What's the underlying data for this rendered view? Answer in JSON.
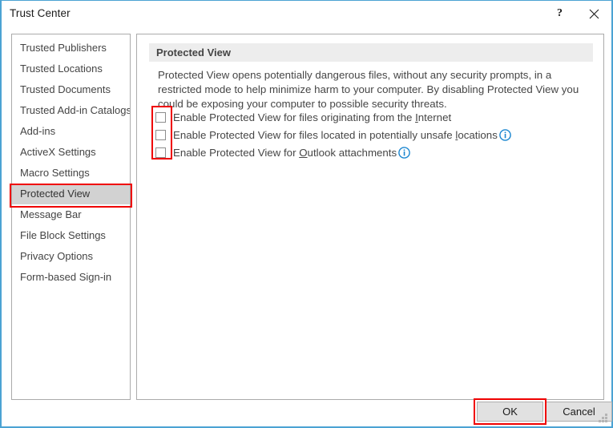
{
  "window": {
    "title": "Trust Center",
    "help_icon": "question-mark-icon",
    "close_icon": "close-icon",
    "accent_color": "#4ba3d3"
  },
  "sidebar": {
    "items": [
      {
        "label": "Trusted Publishers",
        "selected": false
      },
      {
        "label": "Trusted Locations",
        "selected": false
      },
      {
        "label": "Trusted Documents",
        "selected": false
      },
      {
        "label": "Trusted Add-in Catalogs",
        "selected": false
      },
      {
        "label": "Add-ins",
        "selected": false
      },
      {
        "label": "ActiveX Settings",
        "selected": false
      },
      {
        "label": "Macro Settings",
        "selected": false
      },
      {
        "label": "Protected View",
        "selected": true
      },
      {
        "label": "Message Bar",
        "selected": false
      },
      {
        "label": "File Block Settings",
        "selected": false
      },
      {
        "label": "Privacy Options",
        "selected": false
      },
      {
        "label": "Form-based Sign-in",
        "selected": false
      }
    ]
  },
  "main": {
    "section_title": "Protected View",
    "description": "Protected View opens potentially dangerous files, without any security prompts, in a restricted mode to help minimize harm to your computer. By disabling Protected View you could be exposing your computer to possible security threats.",
    "checkboxes": [
      {
        "label_before": "Enable Protected View for files originating from the ",
        "accelerator": "I",
        "label_after": "nternet",
        "checked": false,
        "info_icon": false
      },
      {
        "label_before": "Enable Protected View for files located in potentially unsafe ",
        "accelerator": "l",
        "label_after": "ocations",
        "checked": false,
        "info_icon": true
      },
      {
        "label_before": "Enable Protected View for ",
        "accelerator": "O",
        "label_after": "utlook attachments",
        "checked": false,
        "info_icon": true
      }
    ],
    "info_icon_color": "#1a86d0"
  },
  "footer": {
    "ok_label": "OK",
    "cancel_label": "Cancel"
  },
  "annotations": {
    "color": "#ef0000",
    "targets": [
      "sidebar-item-protected-view",
      "protected-view-checkbox-group",
      "ok-button"
    ]
  }
}
